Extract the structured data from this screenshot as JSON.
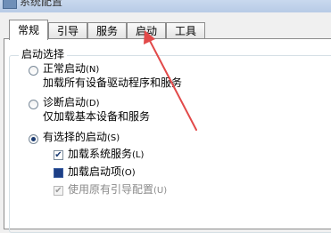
{
  "window": {
    "title": "系统配置"
  },
  "tabs": [
    {
      "label": "常规",
      "active": true
    },
    {
      "label": "引导",
      "active": false
    },
    {
      "label": "服务",
      "active": false
    },
    {
      "label": "启动",
      "active": false
    },
    {
      "label": "工具",
      "active": false
    }
  ],
  "startup_selection": {
    "label": "启动选择",
    "normal": {
      "label": "正常启动",
      "key": "(N)",
      "desc": "加载所有设备驱动程序和服务",
      "checked": false
    },
    "diagnostic": {
      "label": "诊断启动",
      "key": "(D)",
      "desc": "仅加载基本设备和服务",
      "checked": false
    },
    "selective": {
      "label": "有选择的启动",
      "key": "(S)",
      "checked": true
    },
    "options": [
      {
        "label": "加载系统服务",
        "key": "(L)",
        "state": "checked"
      },
      {
        "label": "加载启动项",
        "key": "(O)",
        "state": "indeterminate"
      },
      {
        "label": "使用原有引导配置",
        "key": "(U)",
        "state": "disabled-checked"
      }
    ]
  },
  "annotation": {
    "arrow_color": "#e24a4a"
  }
}
